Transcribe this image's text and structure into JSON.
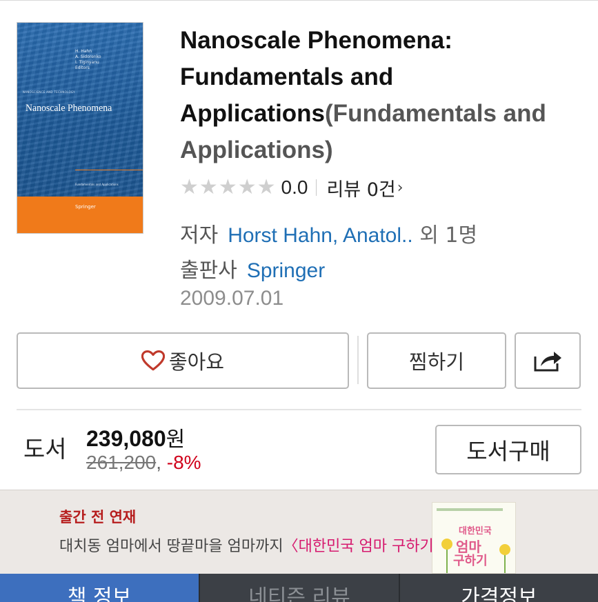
{
  "book": {
    "title_main": "Nanoscale Phenomena: Fundamentals and Applications",
    "title_sub": "(Fundamentals and Applications)",
    "cover": {
      "authors": [
        "H. Hahn",
        "A. Sidorenko",
        "I. Tiginyanu"
      ],
      "editors": "Editors",
      "series": "NANOSCIENCE AND TECHNOLOGY",
      "title": "Nanoscale Phenomena",
      "subtitle": "Fundamentals and Applications",
      "publisher": "Springer"
    },
    "rating": {
      "value": 0.0,
      "score_text": "0.0",
      "review_text": "리뷰 0건",
      "stars_total": 5,
      "stars_filled": 0
    },
    "author_label": "저자",
    "authors_text": "Horst Hahn, Anatol..",
    "authors_more": "외 1명",
    "publisher_label": "출판사",
    "publisher": "Springer",
    "date": "2009.07.01"
  },
  "actions": {
    "like_label": "좋아요",
    "wish_label": "찜하기",
    "share_icon": "share-icon"
  },
  "price": {
    "type_label": "도서",
    "amount": "239,080",
    "currency": "원",
    "original": "261,200",
    "discount": "-8%",
    "buy_label": "도서구매"
  },
  "banner": {
    "tag": "출간 전 연재",
    "text": "대치동 엄마에서 땅끝마을 엄마까지",
    "highlight": "〈대한민국 엄마 구하기〉",
    "book_line1": "대한민국",
    "book_line2": "엄마",
    "book_line3": "구하기"
  },
  "tabs": [
    "책 정보",
    "네티즌 리뷰",
    "가격정보"
  ],
  "colors": {
    "accent": "#1f6fb5",
    "discount": "#d0021b",
    "tab_active": "#3d6fbe",
    "tab_bar": "#2f3338",
    "heart": "#c0392b"
  }
}
